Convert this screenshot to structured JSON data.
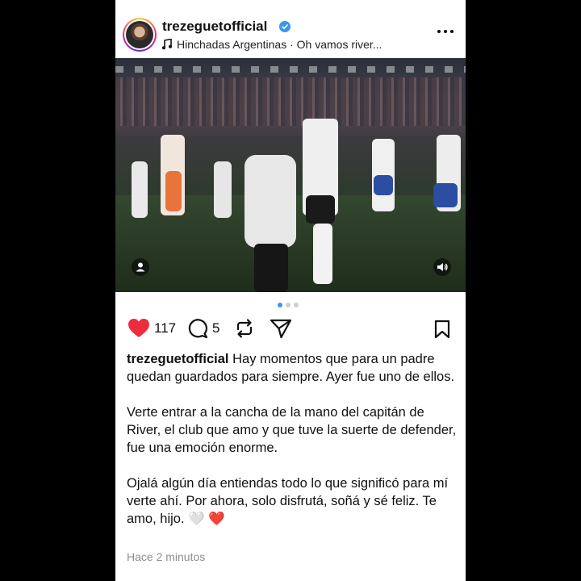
{
  "post": {
    "username": "trezeguetofficial",
    "music": "Hinchadas Argentinas · Oh vamos river...",
    "likes": "117",
    "comments": "5",
    "caption_p1": "Hay momentos que para un padre quedan guardados para siempre. Ayer fue uno de ellos.",
    "caption_p2": "Verte entrar a la cancha de la mano del capitán de River, el club que amo y que tuve la suerte de defender, fue una emoción enorme.",
    "caption_p3": "Ojalá algún día entiendas todo lo que significó para mí verte ahí. Por ahora, solo disfrutá, soñá y sé feliz. Te amo, hijo. 🤍 ❤️",
    "timestamp": "Hace 2 minutos"
  },
  "carousel": {
    "current": 1,
    "total": 3
  },
  "colors": {
    "like": "#ed2d3e",
    "verified": "#3897f0",
    "dot_active": "#3897f0"
  },
  "icons": [
    "verified-badge-icon",
    "music-note-icon",
    "more-options-icon",
    "heart-icon",
    "comment-icon",
    "repost-icon",
    "share-icon",
    "bookmark-icon",
    "tagged-users-icon",
    "sound-icon"
  ]
}
